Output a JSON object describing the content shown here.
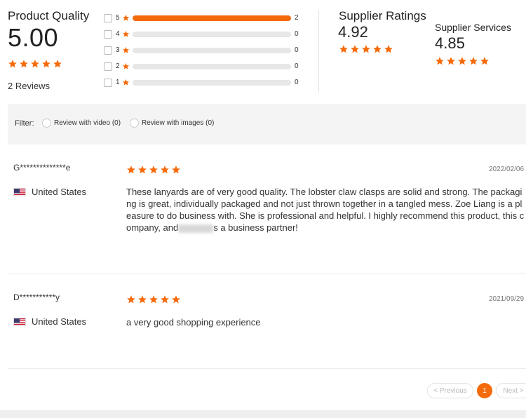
{
  "colors": {
    "accent": "#f56a0a",
    "bar_bg": "#e7e7e7",
    "filter_bg": "#f4f4f4"
  },
  "product_quality": {
    "title": "Product Quality",
    "score": "5.00",
    "stars": 5,
    "review_count": "2 Reviews"
  },
  "distribution": [
    {
      "stars": "5",
      "count": "2",
      "fraction": 1.0
    },
    {
      "stars": "4",
      "count": "0",
      "fraction": 0
    },
    {
      "stars": "3",
      "count": "0",
      "fraction": 0
    },
    {
      "stars": "2",
      "count": "0",
      "fraction": 0
    },
    {
      "stars": "1",
      "count": "0",
      "fraction": 0
    }
  ],
  "supplier_ratings": {
    "title": "Supplier Ratings",
    "score": "4.92",
    "stars": 5
  },
  "supplier_services": {
    "title": "Supplier Services",
    "score": "4.85",
    "stars": 5
  },
  "filter": {
    "label": "Filter:",
    "options": [
      "Review with video (0)",
      "Review with images (0)"
    ]
  },
  "reviews": [
    {
      "name": "G**************e",
      "country": "United States",
      "date": "2022/02/06",
      "stars": 5,
      "text_before": "These lanyards are of very good quality. The lobster claw clasps are solid and strong. The packaging is great, individually packaged and not just thrown together in a tangled mess. Zoe Liang is a pleasure to do business with. She is professional and helpful. I highly recommend this product, this company, and",
      "text_after": "s a business partner!"
    },
    {
      "name": "D***********y",
      "country": "United States",
      "date": "2021/09/29",
      "stars": 5,
      "text_before": "a very good shopping experience",
      "text_after": ""
    }
  ],
  "pagination": {
    "previous": "< Previous",
    "current": "1",
    "next": "Next >"
  }
}
